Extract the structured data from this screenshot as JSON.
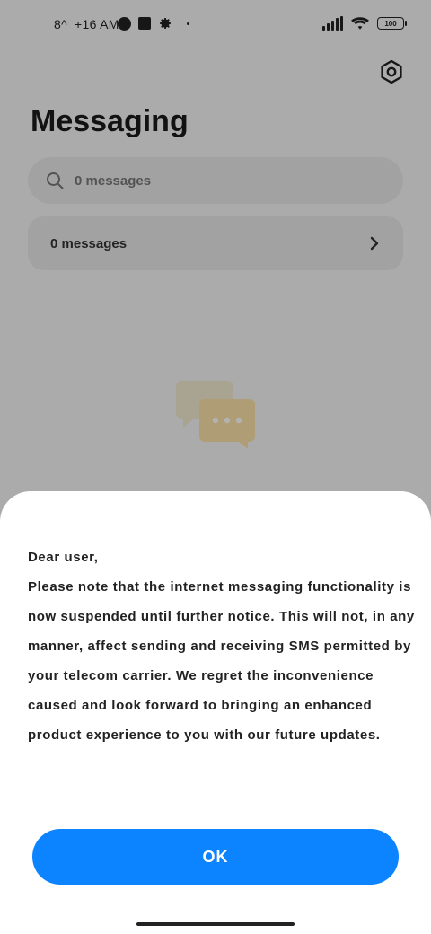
{
  "status_bar": {
    "time": "8^_+16 AM",
    "battery": "100",
    "icons": [
      "app-circle-icon",
      "square-notification-icon",
      "settings-gear-icon",
      "dot-icon",
      "signal-icon",
      "wifi-icon",
      "battery-icon"
    ]
  },
  "header": {
    "title": "Messaging",
    "settings_icon": "hexagon-settings-icon"
  },
  "search": {
    "placeholder": "0 messages",
    "value": ""
  },
  "messages_row": {
    "label": "0 messages",
    "chevron_icon": "chevron-right-icon"
  },
  "empty_state": {
    "icon": "chat-bubbles-icon"
  },
  "dialog": {
    "greeting": "Dear user,",
    "body": "Please note that the internet messaging functionality is now suspended until further notice. This will not, in any manner, affect sending and receiving SMS permitted by your telecom carrier. We regret the inconvenience caused and look forward to bringing an enhanced product experience to you with our future updates.",
    "ok_label": "OK",
    "accent_color": "#0d84ff"
  }
}
